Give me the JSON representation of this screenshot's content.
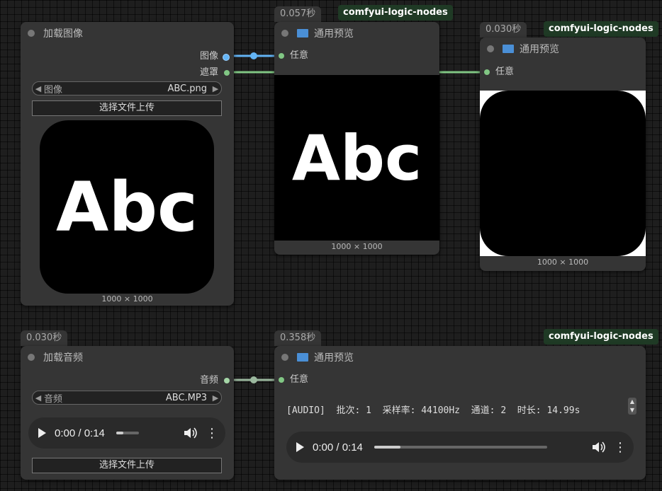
{
  "node_load_image": {
    "title": "加载图像",
    "outputs": [
      "图像",
      "遮罩"
    ],
    "widget_label": "图像",
    "widget_value": "ABC.png",
    "upload_label": "选择文件上传",
    "preview_text": "Abc",
    "size": "1000 × 1000"
  },
  "node_preview1": {
    "timing": "0.057秒",
    "badge": "comfyui-logic-nodes",
    "title": "通用预览",
    "input": "任意",
    "preview_text": "Abc",
    "size": "1000 × 1000"
  },
  "node_preview2": {
    "timing": "0.030秒",
    "badge": "comfyui-logic-nodes",
    "title": "通用预览",
    "input": "任意",
    "size": "1000 × 1000"
  },
  "node_load_audio": {
    "timing": "0.030秒",
    "title": "加载音频",
    "output": "音频",
    "widget_label": "音频",
    "widget_value": "ABC.MP3",
    "time": "0:00 / 0:14",
    "progress": 0.2,
    "upload_label": "选择文件上传"
  },
  "node_preview3": {
    "timing": "0.358秒",
    "badge": "comfyui-logic-nodes",
    "title": "通用预览",
    "input": "任意",
    "audio_info": "[AUDIO]  批次: 1  采样率: 44100Hz  通道: 2  时长: 14.99s",
    "time": "0:00 / 0:14",
    "progress": 0.15
  },
  "colors": {
    "image_link": "#64b5f6",
    "mask_link": "#81c784",
    "audio_link": "#a5d6a7"
  }
}
